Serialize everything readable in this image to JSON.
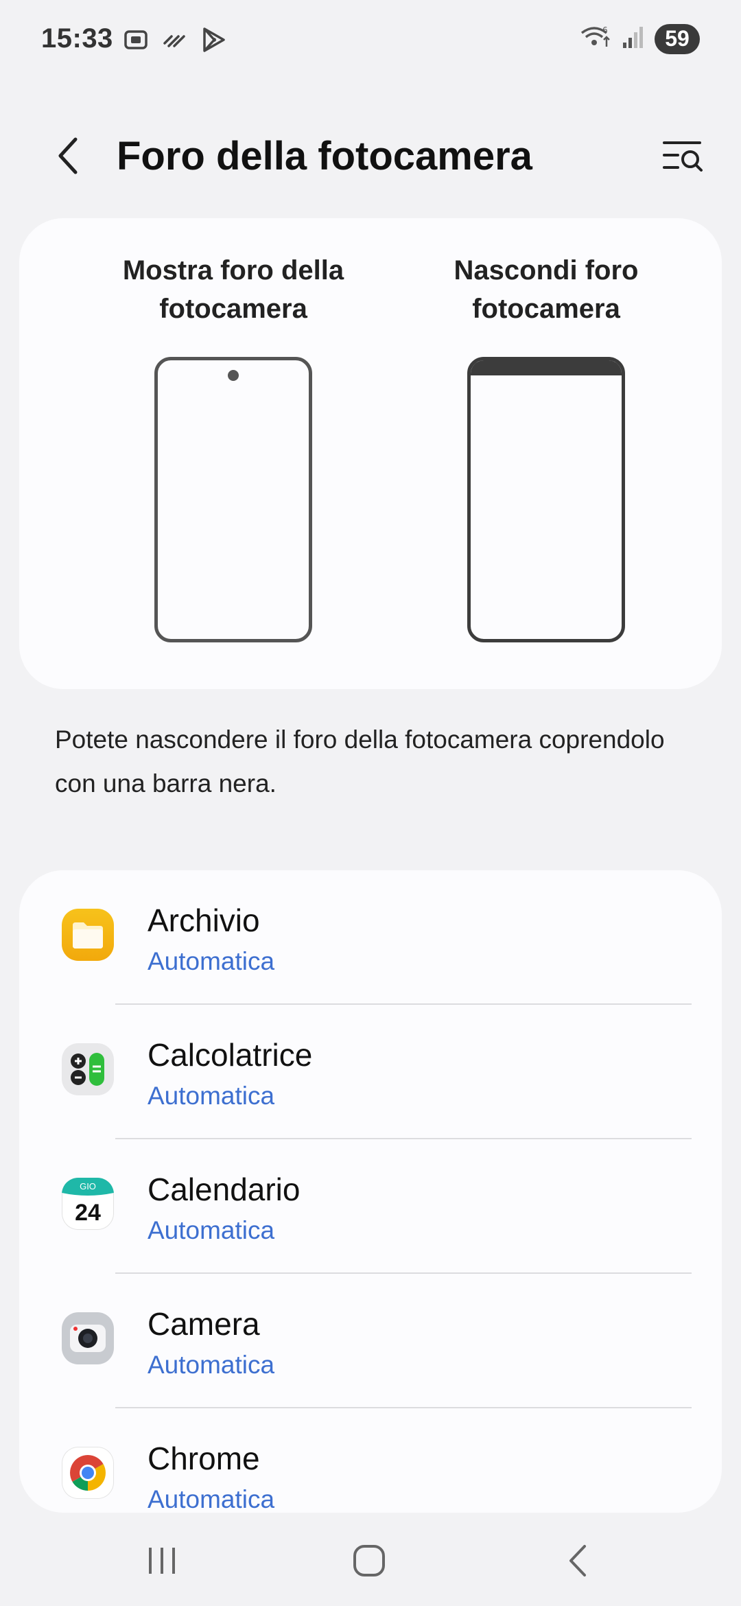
{
  "status_bar": {
    "time": "15:33",
    "battery": "59",
    "left_icons": [
      "screenshot-icon",
      "signal-lines-icon",
      "play-store-icon"
    ],
    "right_icons": [
      "wifi-icon",
      "cell-signal-icon"
    ]
  },
  "app_bar": {
    "title": "Foro della fotocamera",
    "back_icon": "chevron-left-icon",
    "search_icon": "search-list-icon"
  },
  "preview": {
    "show_label": "Mostra foro della\nfotocamera",
    "hide_label": "Nascondi foro\nfotocamera"
  },
  "description": "Potete nascondere il foro della fotocamera coprendolo con una barra nera.",
  "apps": [
    {
      "name": "Archivio",
      "mode": "Automatica",
      "icon": "folder-icon"
    },
    {
      "name": "Calcolatrice",
      "mode": "Automatica",
      "icon": "calculator-icon"
    },
    {
      "name": "Calendario",
      "mode": "Automatica",
      "icon": "calendar-icon",
      "icon_day": "GIO",
      "icon_date": "24"
    },
    {
      "name": "Camera",
      "mode": "Automatica",
      "icon": "camera-icon"
    },
    {
      "name": "Chrome",
      "mode": "Automatica",
      "icon": "chrome-icon"
    }
  ],
  "nav": {
    "recents_icon": "recents-icon",
    "home_icon": "home-icon",
    "back_icon": "back-icon"
  },
  "colors": {
    "background": "#f2f2f4",
    "card": "#fcfcfe",
    "accent_blue": "#3d6fd0"
  }
}
